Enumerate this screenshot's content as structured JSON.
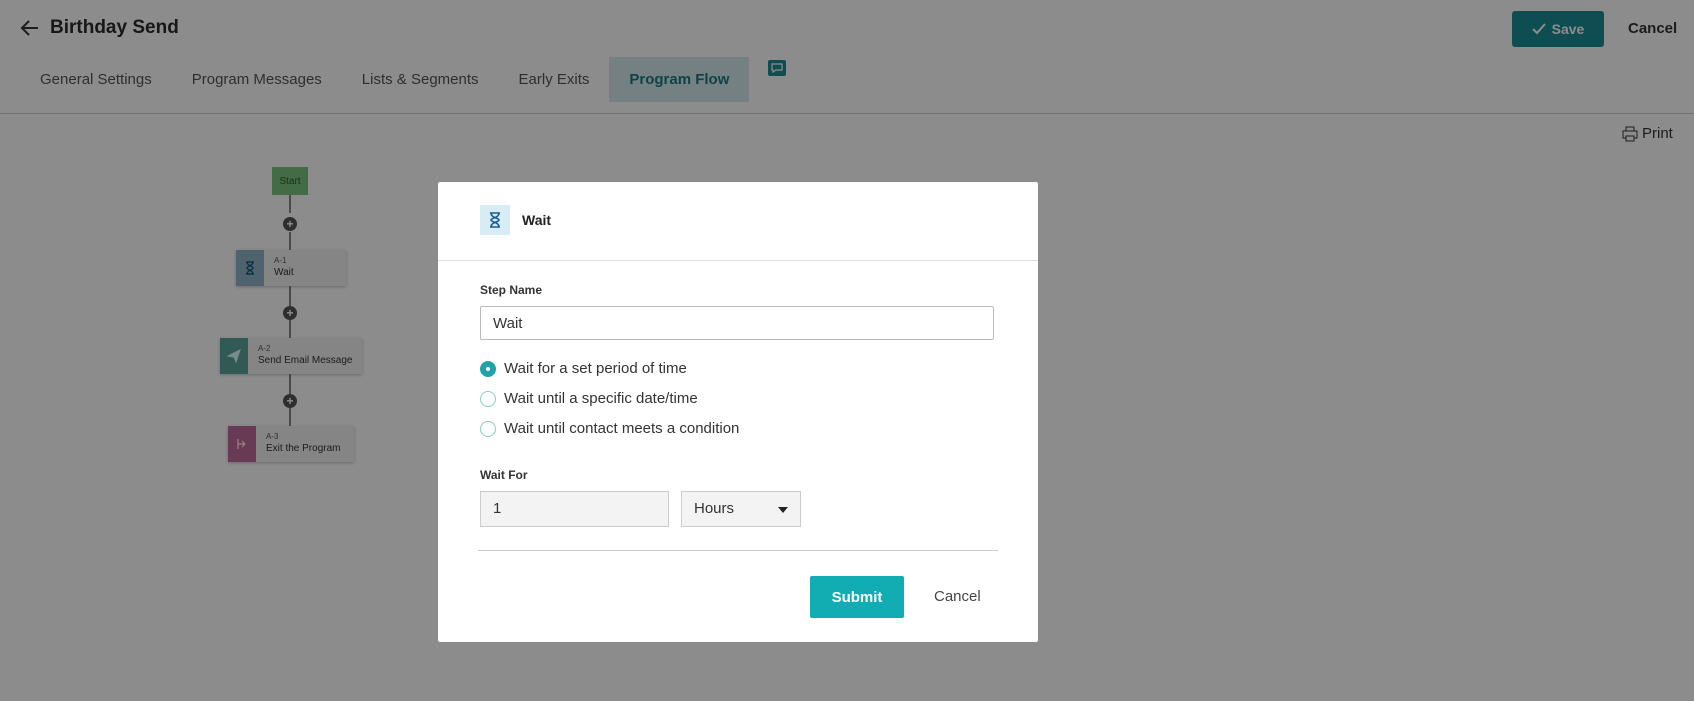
{
  "header": {
    "title": "Birthday Send",
    "save_label": "Save",
    "cancel_label": "Cancel",
    "tabs": [
      {
        "label": "General Settings"
      },
      {
        "label": "Program Messages"
      },
      {
        "label": "Lists & Segments"
      },
      {
        "label": "Early Exits"
      },
      {
        "label": "Program Flow"
      }
    ],
    "active_tab": "Program Flow",
    "print_label": "Print"
  },
  "flow": {
    "start_label": "Start",
    "nodes": [
      {
        "id": "A-1",
        "name": "Wait",
        "icon": "hourglass-icon",
        "color": "#8fb4c9"
      },
      {
        "id": "A-2",
        "name": "Send Email Message",
        "icon": "paper-plane-icon",
        "color": "#5aa59a"
      },
      {
        "id": "A-3",
        "name": "Exit the Program",
        "icon": "exit-icon",
        "color": "#c06a9a"
      }
    ]
  },
  "modal": {
    "title": "Wait",
    "step_name_label": "Step Name",
    "step_name_value": "Wait",
    "options": [
      {
        "label": "Wait for a set period of time",
        "selected": true
      },
      {
        "label": "Wait until a specific date/time",
        "selected": false
      },
      {
        "label": "Wait until contact meets a condition",
        "selected": false
      }
    ],
    "wait_for_label": "Wait For",
    "wait_for_value": "1",
    "unit_value": "Hours",
    "submit_label": "Submit",
    "cancel_label": "Cancel"
  },
  "colors": {
    "accent": "#1b8f96",
    "submit": "#12adb3",
    "active_tab_bg": "#d4eaec"
  }
}
